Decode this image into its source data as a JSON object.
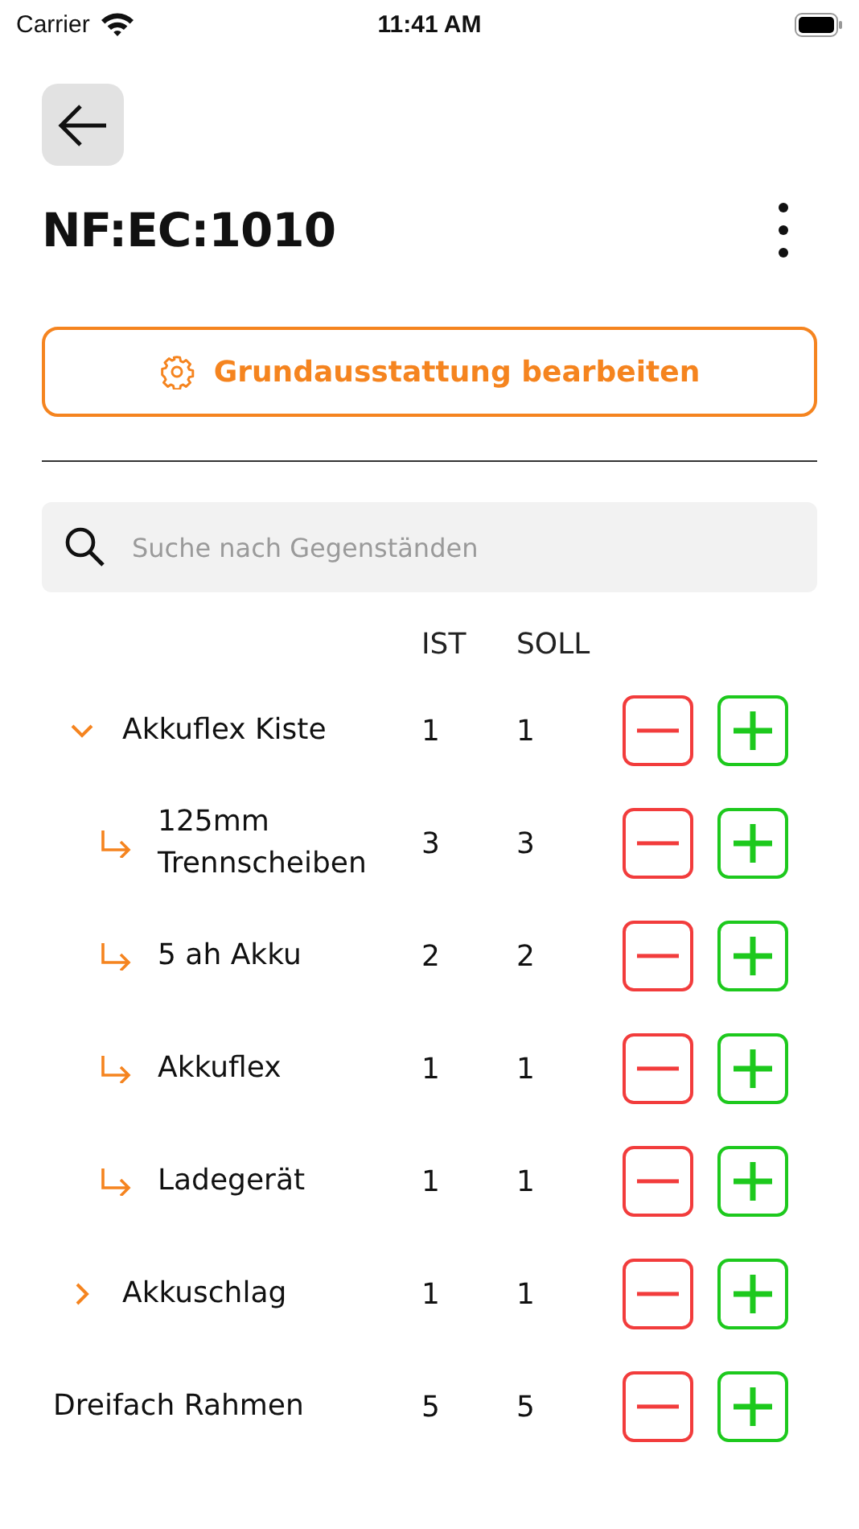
{
  "status_bar": {
    "carrier": "Carrier",
    "time": "11:41 AM"
  },
  "header": {
    "title": "NF:EC:1010"
  },
  "edit_button": {
    "label": "Grundausstattung bearbeiten"
  },
  "search": {
    "placeholder": "Suche nach Gegenständen"
  },
  "columns": [
    "IST",
    "SOLL"
  ],
  "items": [
    {
      "kind": "group",
      "name": "Akkuflex Kiste",
      "ist": "1",
      "soll": "1",
      "expanded": true,
      "children": [
        {
          "name": "125mm Trennscheiben",
          "ist": "3",
          "soll": "3"
        },
        {
          "name": "5 ah Akku",
          "ist": "2",
          "soll": "2"
        },
        {
          "name": "Akkuflex",
          "ist": "1",
          "soll": "1"
        },
        {
          "name": "Ladegerät",
          "ist": "1",
          "soll": "1"
        }
      ]
    },
    {
      "kind": "group",
      "name": "Akkuschlag",
      "ist": "1",
      "soll": "1",
      "expanded": false
    },
    {
      "kind": "item",
      "name": "Dreifach Rahmen",
      "ist": "5",
      "soll": "5"
    }
  ]
}
